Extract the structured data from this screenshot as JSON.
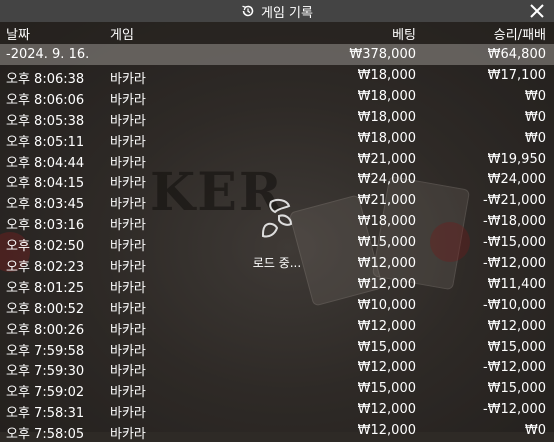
{
  "title": "게임 기록",
  "loading_text": "로드 중...",
  "columns": {
    "date": "날짜",
    "game": "게임",
    "bet": "베팅",
    "result": "승리/패배"
  },
  "summary": {
    "date": "-2024. 9. 16.",
    "bet": "₩378,000",
    "result": "₩64,800"
  },
  "rows": [
    {
      "time": "오후 8:06:38",
      "game": "바카라",
      "bet": "₩18,000",
      "result": "₩17,100"
    },
    {
      "time": "오후 8:06:06",
      "game": "바카라",
      "bet": "₩18,000",
      "result": "₩0"
    },
    {
      "time": "오후 8:05:38",
      "game": "바카라",
      "bet": "₩18,000",
      "result": "₩0"
    },
    {
      "time": "오후 8:05:11",
      "game": "바카라",
      "bet": "₩18,000",
      "result": "₩0"
    },
    {
      "time": "오후 8:04:44",
      "game": "바카라",
      "bet": "₩21,000",
      "result": "₩19,950"
    },
    {
      "time": "오후 8:04:15",
      "game": "바카라",
      "bet": "₩24,000",
      "result": "₩24,000"
    },
    {
      "time": "오후 8:03:45",
      "game": "바카라",
      "bet": "₩21,000",
      "result": "-₩21,000"
    },
    {
      "time": "오후 8:03:16",
      "game": "바카라",
      "bet": "₩18,000",
      "result": "-₩18,000"
    },
    {
      "time": "오후 8:02:50",
      "game": "바카라",
      "bet": "₩15,000",
      "result": "-₩15,000"
    },
    {
      "time": "오후 8:02:23",
      "game": "바카라",
      "bet": "₩12,000",
      "result": "-₩12,000"
    },
    {
      "time": "오후 8:01:25",
      "game": "바카라",
      "bet": "₩12,000",
      "result": "₩11,400"
    },
    {
      "time": "오후 8:00:52",
      "game": "바카라",
      "bet": "₩10,000",
      "result": "-₩10,000"
    },
    {
      "time": "오후 8:00:26",
      "game": "바카라",
      "bet": "₩12,000",
      "result": "₩12,000"
    },
    {
      "time": "오후 7:59:58",
      "game": "바카라",
      "bet": "₩15,000",
      "result": "₩15,000"
    },
    {
      "time": "오후 7:59:30",
      "game": "바카라",
      "bet": "₩12,000",
      "result": "-₩12,000"
    },
    {
      "time": "오후 7:59:02",
      "game": "바카라",
      "bet": "₩15,000",
      "result": "₩15,000"
    },
    {
      "time": "오후 7:58:31",
      "game": "바카라",
      "bet": "₩12,000",
      "result": "-₩12,000"
    },
    {
      "time": "오후 7:58:05",
      "game": "바카라",
      "bet": "₩12,000",
      "result": "₩0"
    }
  ],
  "background_text": "KER",
  "icons": {
    "title": "history-icon",
    "close": "close-icon",
    "loader": "spinner-icon"
  }
}
